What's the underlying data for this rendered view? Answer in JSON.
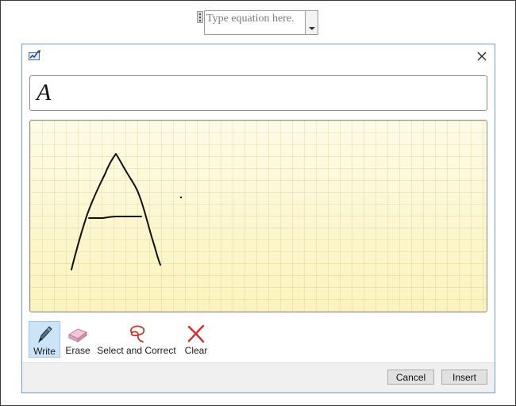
{
  "equation_placeholder": {
    "text": "Type equation here."
  },
  "dialog": {
    "preview_text": "A",
    "toolbar": {
      "write_label": "Write",
      "erase_label": "Erase",
      "select_label": "Select and Correct",
      "clear_label": "Clear"
    },
    "buttons": {
      "cancel_label": "Cancel",
      "insert_label": "Insert"
    }
  },
  "icons": {
    "app": "math-input-icon",
    "close": "close-icon",
    "write": "pen-icon",
    "erase": "eraser-icon",
    "select": "lasso-icon",
    "clear": "clear-x-icon",
    "dropdown": "chevron-down-icon"
  },
  "colors": {
    "dialog_border": "#6b9bd1",
    "ink_pad_bg": "#fdf8d2",
    "write_selected_bg": "#cce4f7",
    "clear_red": "#d42b2b",
    "lasso_red": "#c0392b",
    "eraser_pink": "#e8a6c4"
  }
}
